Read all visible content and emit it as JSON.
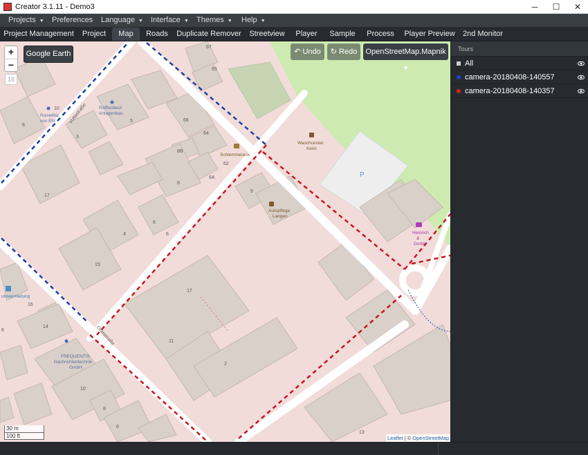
{
  "window": {
    "title": "Creator 3.1.11 - Demo3",
    "minimize": "─",
    "maximize": "☐",
    "close": "✕"
  },
  "menu": [
    {
      "label": "Projects",
      "caret": "▼"
    },
    {
      "label": "Preferences",
      "caret": ""
    },
    {
      "label": "Language",
      "caret": "▼"
    },
    {
      "label": "Interface",
      "caret": "▼"
    },
    {
      "label": "Themes",
      "caret": "▼"
    },
    {
      "label": "Help",
      "caret": "▼"
    }
  ],
  "tabs": [
    {
      "label": "Project Management"
    },
    {
      "label": "Project"
    },
    {
      "label": "Map",
      "active": true
    },
    {
      "label": "Roads"
    },
    {
      "label": "Duplicate Remover"
    },
    {
      "label": "Streetview"
    },
    {
      "label": "Player"
    },
    {
      "label": "Sample"
    },
    {
      "label": "Process"
    },
    {
      "label": "Player Preview"
    },
    {
      "label": "2nd Monitor"
    }
  ],
  "map": {
    "zoom_in": "+",
    "zoom_out": "−",
    "zoom_level": "18",
    "google_earth": "Google Earth",
    "undo": "Undo",
    "redo": "Redo",
    "basemap": "OpenStreetMap.Mapnik",
    "basemap_caret": "▾",
    "scale_metric": "30 m",
    "scale_imperial": "100 ft",
    "attribution_leaflet": "Leaflet",
    "attribution_sep": " | © ",
    "attribution_osm": "OpenStreetMap",
    "labels": {
      "voltastrasse": "Voltastraße",
      "ohmstrasse": "Ohmstraße",
      "raffl": [
        "Rafflenbeul",
        "Anlagenbau"
      ],
      "roswitha": [
        "Roswitha",
        "von Ehr"
      ],
      "schlemmer": "Schlemmereck",
      "wasch": [
        "Waschcenter",
        "Keim"
      ],
      "autopflege": [
        "Autopflege",
        "Langen"
      ],
      "heinrich": [
        "Heinrich",
        "&",
        "GmbH"
      ],
      "frequentis": [
        "FREQUENTIS",
        "Nachrichtentechnik",
        "GmbH"
      ],
      "autovermietung": "utovermietung",
      "parking": "P",
      "numbers": [
        "67",
        "65",
        "10",
        "8",
        "5",
        "66",
        "64",
        "3",
        "8B",
        "62",
        "8A",
        "8",
        "9",
        "17",
        "6",
        "6",
        "4",
        "15",
        "17",
        "16",
        "14",
        "11",
        "2",
        "10",
        "8",
        "6",
        "13",
        "6"
      ]
    },
    "colors": {
      "route_blue": "#1a3fa0",
      "route_red": "#c8141e",
      "road": "#ffffff",
      "building": "#d9d0c9",
      "green": "#cdebb0",
      "parking_lot": "#eeeeee"
    }
  },
  "sidebar": {
    "header": "Tours",
    "tours": [
      {
        "label": "All",
        "color": "#cccccc",
        "icon": "eye-icon"
      },
      {
        "label": "camera-20180408-140557",
        "color": "#1f3fd6",
        "icon": "eye-icon"
      },
      {
        "label": "camera-20180408-140357",
        "color": "#e0201e",
        "icon": "eye-icon"
      }
    ]
  }
}
